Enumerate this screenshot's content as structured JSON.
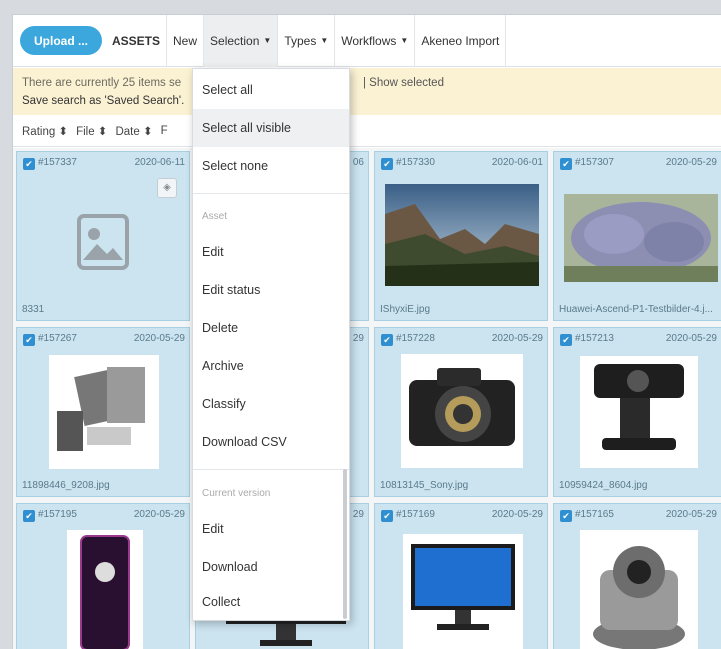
{
  "toolbar": {
    "upload_label": "Upload ...",
    "assets_label": "ASSETS",
    "new_label": "New",
    "selection_label": "Selection",
    "types_label": "Types",
    "workflows_label": "Workflows",
    "akeneo_label": "Akeneo Import"
  },
  "info": {
    "line1": "There are currently 25 items se",
    "line2": "Save search as 'Saved Search'.",
    "show_selected": "| Show selected"
  },
  "sort": [
    "Rating ⬍",
    "File ⬍",
    "Date ⬍",
    "F"
  ],
  "selection_menu": {
    "items_top": [
      "Select all",
      "Select all visible",
      "Select none"
    ],
    "asset_header": "Asset",
    "asset_items": [
      "Edit",
      "Edit status",
      "Delete",
      "Archive",
      "Classify",
      "Download CSV"
    ],
    "version_header": "Current version",
    "version_items": [
      "Edit",
      "Download",
      "Collect"
    ]
  },
  "tiles": [
    {
      "id": "#157337",
      "date": "2020-06-11",
      "file": "8331",
      "thumb": "placeholder-icon"
    },
    {
      "id": "",
      "date": "06",
      "file": "",
      "thumb": "hidden"
    },
    {
      "id": "#157330",
      "date": "2020-06-01",
      "file": "IShyxiE.jpg",
      "thumb": "landscape"
    },
    {
      "id": "#157307",
      "date": "2020-05-29",
      "file": "Huawei-Ascend-P1-Testbilder-4.j...",
      "thumb": "lavender"
    },
    {
      "id": "#157267",
      "date": "2020-05-29",
      "file": "11898446_9208.jpg",
      "thumb": "devices"
    },
    {
      "id": "",
      "date": "29",
      "file": "",
      "thumb": "hidden"
    },
    {
      "id": "#157228",
      "date": "2020-05-29",
      "file": "10813145_Sony.jpg",
      "thumb": "camera"
    },
    {
      "id": "#157213",
      "date": "2020-05-29",
      "file": "10959424_8604.jpg",
      "thumb": "webcam"
    },
    {
      "id": "#157195",
      "date": "2020-05-29",
      "file": "",
      "thumb": "player"
    },
    {
      "id": "",
      "date": "29",
      "file": "",
      "thumb": "monitor-small"
    },
    {
      "id": "#157169",
      "date": "2020-05-29",
      "file": "",
      "thumb": "monitor"
    },
    {
      "id": "#157165",
      "date": "2020-05-29",
      "file": "",
      "thumb": "ptz-camera"
    }
  ],
  "colors": {
    "accent": "#3ca7dc",
    "tile_bg": "#cbe4f0",
    "info_bg": "#fbf2d4"
  }
}
